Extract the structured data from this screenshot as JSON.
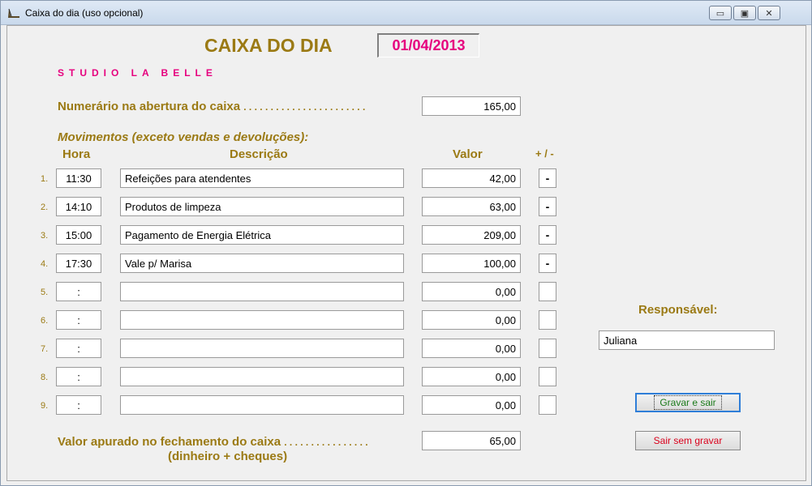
{
  "window": {
    "title": "Caixa do dia (uso opcional)",
    "controls": {
      "minimize": "▭",
      "maximize": "▣",
      "close": "✕"
    }
  },
  "header": {
    "title": "CAIXA DO DIA",
    "date": "01/04/2013",
    "studio": "STUDIO LA BELLE"
  },
  "opening": {
    "label": "Numerário na abertura do caixa",
    "dots": ". . . . . . . . . . . . . . . . . . . . . . .",
    "value": "165,00"
  },
  "movements": {
    "title": "Movimentos (exceto vendas e devoluções):",
    "headers": {
      "hora": "Hora",
      "descricao": "Descrição",
      "valor": "Valor",
      "sign": "+ / -"
    },
    "rows": [
      {
        "num": "1.",
        "hora": "11:30",
        "desc": "Refeições para atendentes",
        "valor": "42,00",
        "sign": "-"
      },
      {
        "num": "2.",
        "hora": "14:10",
        "desc": "Produtos de limpeza",
        "valor": "63,00",
        "sign": "-"
      },
      {
        "num": "3.",
        "hora": "15:00",
        "desc": "Pagamento de Energia Elétrica",
        "valor": "209,00",
        "sign": "-"
      },
      {
        "num": "4.",
        "hora": "17:30",
        "desc": "Vale p/ Marisa",
        "valor": "100,00",
        "sign": "-"
      },
      {
        "num": "5.",
        "hora": ":",
        "desc": "",
        "valor": "0,00",
        "sign": ""
      },
      {
        "num": "6.",
        "hora": ":",
        "desc": "",
        "valor": "0,00",
        "sign": ""
      },
      {
        "num": "7.",
        "hora": ":",
        "desc": "",
        "valor": "0,00",
        "sign": ""
      },
      {
        "num": "8.",
        "hora": ":",
        "desc": "",
        "valor": "0,00",
        "sign": ""
      },
      {
        "num": "9.",
        "hora": ":",
        "desc": "",
        "valor": "0,00",
        "sign": ""
      }
    ]
  },
  "closing": {
    "label": "Valor apurado no fechamento do caixa",
    "dots": ". . . . . . . . . . . . . . . .",
    "sublabel": "(dinheiro + cheques)",
    "value": "65,00"
  },
  "responsible": {
    "label": "Responsável:",
    "value": "Juliana"
  },
  "buttons": {
    "save": "Gravar e sair",
    "exit": "Sair sem gravar"
  },
  "colors": {
    "gold": "#9b7a14",
    "magenta": "#e6007e",
    "save_text": "#1a7a1a",
    "exit_text": "#d9001b"
  }
}
